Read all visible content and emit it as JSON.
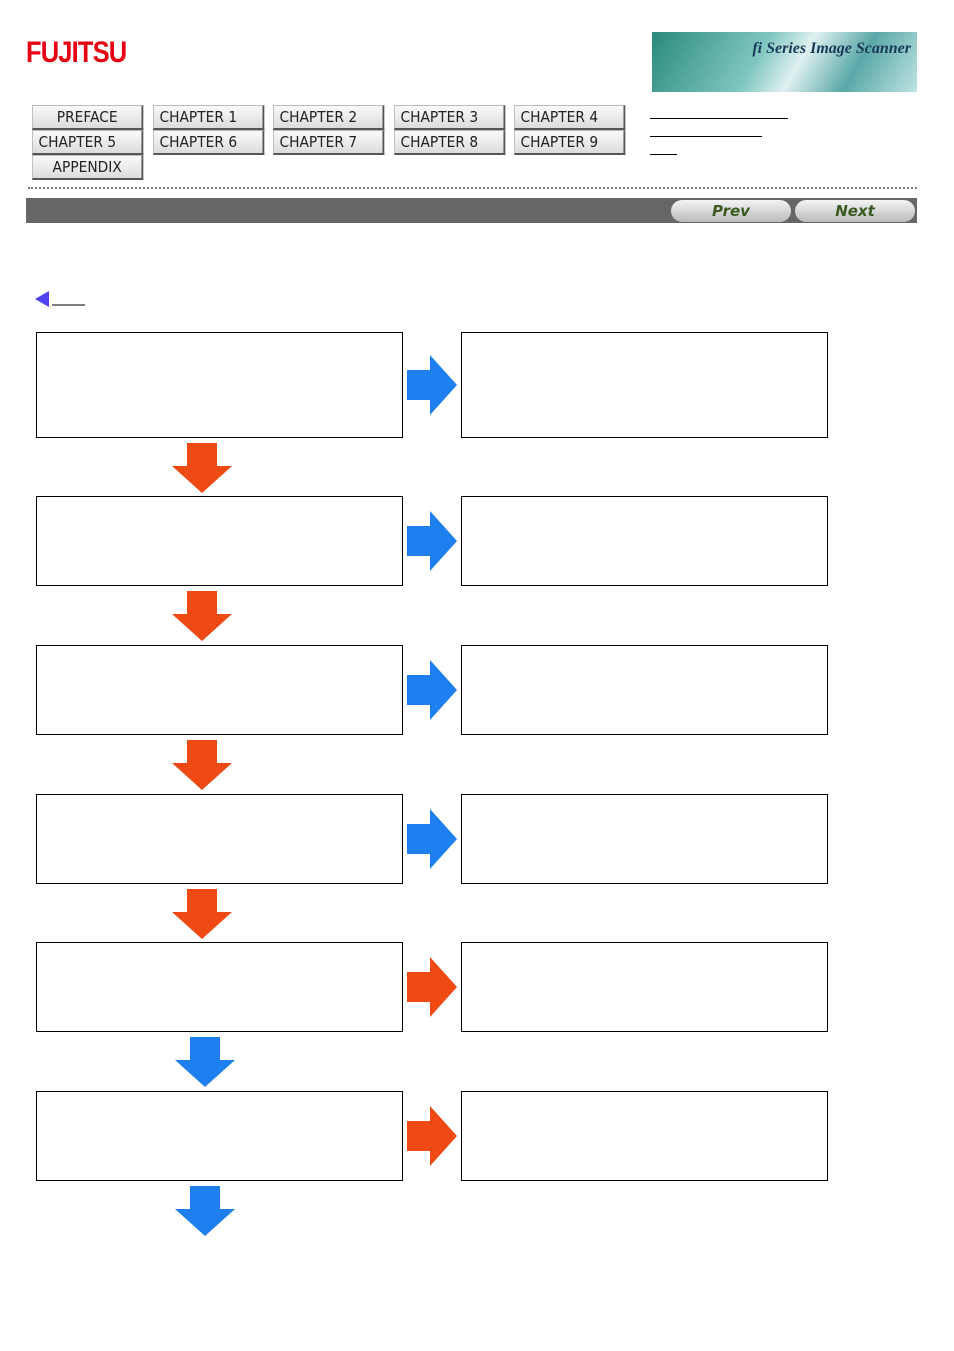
{
  "header": {
    "logo": "FUJITSU",
    "banner": "fi Series Image Scanner"
  },
  "nav": [
    "PREFACE",
    "CHAPTER 1",
    "CHAPTER 2",
    "CHAPTER 3",
    "CHAPTER 4",
    "CHAPTER 5",
    "CHAPTER 6",
    "CHAPTER 7",
    "CHAPTER 8",
    "CHAPTER 9",
    "APPENDIX"
  ],
  "pager": {
    "prev": "Prev",
    "next": "Next"
  },
  "colors": {
    "blue_arrow": "#1e80f0",
    "orange_arrow": "#f04a14",
    "bar": "#666666"
  },
  "flow": {
    "right_arrows": [
      "blue",
      "blue",
      "blue",
      "blue",
      "orange",
      "orange"
    ],
    "down_arrows": [
      "orange",
      "orange",
      "orange",
      "orange",
      "blue",
      "blue"
    ]
  }
}
